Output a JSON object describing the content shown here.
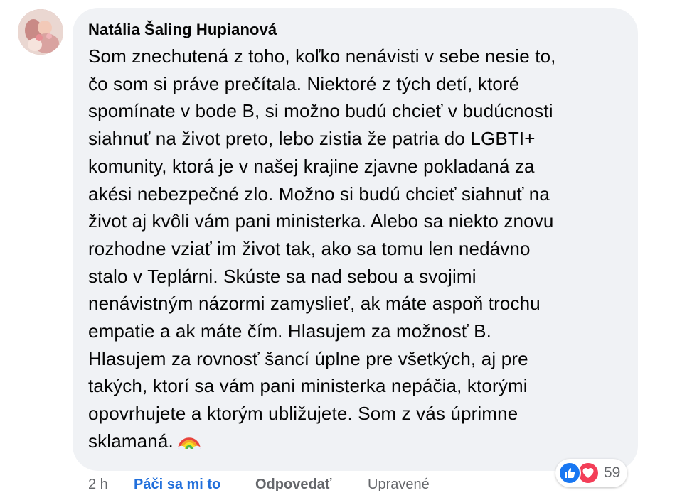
{
  "comment": {
    "author": "Natália Šaling Hupianová",
    "lines": [
      "Som znechutená z toho, koľko nenávisti v sebe nesie to,",
      "čo som si práve prečítala. Niektoré z tých detí, ktoré",
      "spomínate v bode B, si možno budú chcieť v budúcnosti",
      "siahnuť na život preto, lebo zistia že patria do LGBTI+",
      "komunity, ktorá je v našej krajine zjavne pokladaná za",
      "akési nebezpečné zlo. Možno si budú chcieť siahnuť na",
      "život aj kvôli vám pani ministerka. Alebo sa niekto znovu",
      "rozhodne vziať im život tak, ako sa tomu len nedávno",
      "stalo v Teplárni. Skúste sa nad sebou a svojimi",
      "nenávistným názormi zamyslieť, ak máte aspoň trochu",
      "empatie a ak máte čím. Hlasujem za možnosť B.",
      "Hlasujem za rovnosť šancí úplne pre všetkých, aj pre",
      "takých, ktorí sa vám pani ministerka nepáčia, ktorými",
      "opovrhujete a ktorým ubližujete. Som z vás úprimne",
      "sklamaná."
    ],
    "emoji": "rainbow-emoji-icon"
  },
  "actions": {
    "time": "2 h",
    "like_label": "Páči sa mi to",
    "reply_label": "Odpovedať",
    "edited_label": "Upravené"
  },
  "reactions": {
    "count": "59",
    "icons": [
      "like-icon",
      "love-icon"
    ],
    "like_color": "#1877f2",
    "love_color": "#f33e58"
  },
  "colors": {
    "bubble": "#f0f2f5",
    "link_blue": "#216fdb",
    "secondary_text": "#65676b"
  }
}
